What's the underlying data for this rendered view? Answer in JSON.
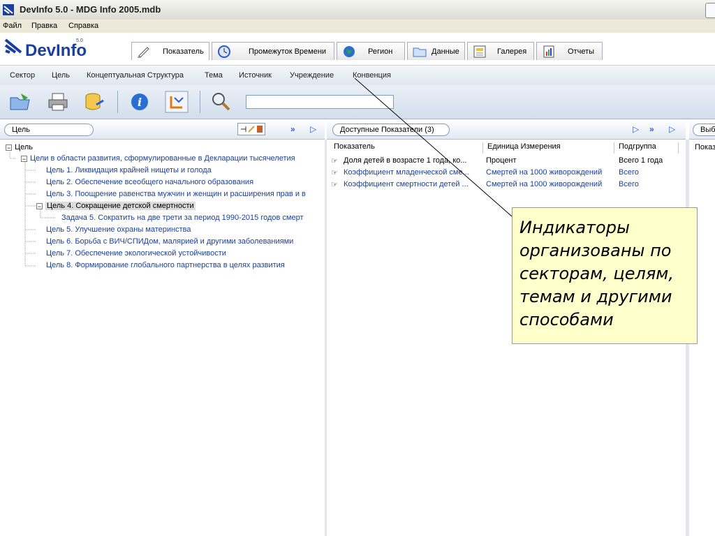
{
  "window": {
    "title": "DevInfo 5.0 - MDG Info 2005.mdb"
  },
  "menu": [
    "Файл",
    "Правка",
    "Справка"
  ],
  "logo": {
    "text": "DevInfo",
    "version": "5.0"
  },
  "tabs": [
    "Показатель",
    "Промежуток Времени",
    "Регион",
    "Данные",
    "Галерея",
    "Отчеты"
  ],
  "subnav": [
    "Сектор",
    "Цель",
    "Концептуальная Структура",
    "Тема",
    "Источник",
    "Учреждение",
    "Конвенция"
  ],
  "search": {
    "value": ""
  },
  "left_panel": {
    "pill": "Цель",
    "tree": {
      "root": "Цель",
      "group": "Цели в области развития, сформулированные в Декларации тысячелетия",
      "items": [
        "Цель 1. Ликвидация крайней нищеты и голода",
        "Цель 2. Обеспечение всеобщего начального образования",
        "Цель 3. Поощрение равенства мужчин и женщин и расширения прав и в",
        "Цель 4. Сокращение детской смертности",
        "Задача 5. Сократить на две трети за период 1990-2015 годов смерт",
        "Цель 5. Улучшение охраны материнства",
        "Цель 6. Борьба с ВИЧ/СПИДом, малярией и другими заболеваниями",
        "Цель 7. Обеспечение экологической устойчивости",
        "Цель 8. Формирование глобального партнерства в целях развития"
      ]
    }
  },
  "mid_panel": {
    "pill": "Доступные Показатели (3)",
    "columns": [
      "Показатель",
      "Единица Измерения",
      "Подгруппа"
    ],
    "rows": [
      [
        "Доля детей в возрасте 1 года, ко...",
        "Процент",
        "Всего 1 года"
      ],
      [
        "Коэффициент младенческой сме...",
        "Смертей на 1000 живорождений",
        "Всего"
      ],
      [
        "Коэффициент смертности детей ...",
        "Смертей на 1000 живорождений",
        "Всего"
      ]
    ]
  },
  "right_panel": {
    "pill": "Выб",
    "column": "Показ"
  },
  "callout": {
    "text": "Индикаторы организованы по секторам, целям, темам и другими способами"
  },
  "colors": {
    "accent": "#1a3fa0",
    "link": "#1b3f9a",
    "callout_bg": "#ffffcc"
  }
}
